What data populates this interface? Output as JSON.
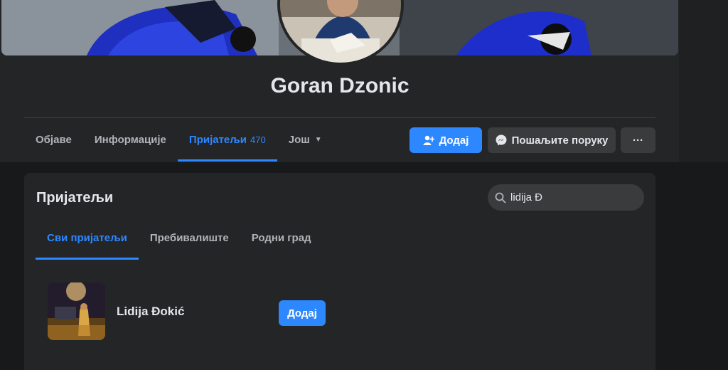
{
  "profile": {
    "name": "Goran Dzonic"
  },
  "tabs": [
    {
      "label": "Објаве"
    },
    {
      "label": "Информације"
    },
    {
      "label": "Пријатељи",
      "count": "470"
    },
    {
      "label": "Још"
    }
  ],
  "actions": {
    "add_label": "Додај",
    "message_label": "Пошаљите поруку",
    "more_label": "···"
  },
  "friends_section": {
    "title": "Пријатељи",
    "search_value": "lidija Đ",
    "subtabs": [
      {
        "label": "Сви пријатељи"
      },
      {
        "label": "Пребивалиште"
      },
      {
        "label": "Родни град"
      }
    ],
    "results": [
      {
        "name": "Lidija Đokić",
        "add_label": "Додај"
      }
    ]
  },
  "icons": {
    "add_friend": "person-plus-icon",
    "messenger": "messenger-icon",
    "search": "search-icon",
    "more": "more-icon",
    "caret": "caret-down-icon"
  },
  "colors": {
    "accent": "#2d88ff",
    "surface": "#242526",
    "background": "#18191a",
    "button_secondary": "#3a3b3c"
  }
}
